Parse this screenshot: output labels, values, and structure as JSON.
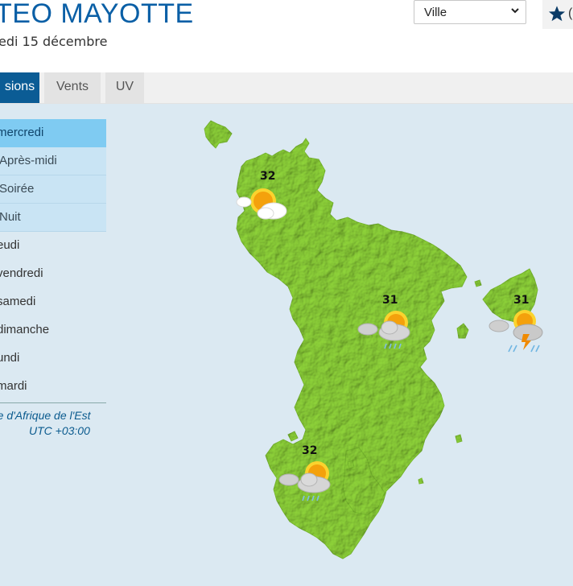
{
  "header": {
    "title": "TEO MAYOTTE",
    "date": "edi 15 décembre",
    "location_select": {
      "value": "Ville"
    },
    "favorite_label": "("
  },
  "tabs": [
    {
      "label": "sions",
      "active": true
    },
    {
      "label": "Vents",
      "active": false
    },
    {
      "label": "UV",
      "active": false
    }
  ],
  "sidebar": {
    "days": [
      {
        "label": "mercredi",
        "state": "active"
      },
      {
        "label": "Après-midi",
        "state": "sub"
      },
      {
        "label": "Soirée",
        "state": "sub"
      },
      {
        "label": "Nuit",
        "state": "sub"
      },
      {
        "label": "eudi",
        "state": "normal"
      },
      {
        "label": "vendredi",
        "state": "normal"
      },
      {
        "label": "samedi",
        "state": "normal"
      },
      {
        "label": "dimanche",
        "state": "normal"
      },
      {
        "label": "undi",
        "state": "normal"
      },
      {
        "label": "mardi",
        "state": "normal"
      }
    ],
    "timezone_line1": "re d'Afrique de l'Est",
    "timezone_line2": "UTC +03:00"
  },
  "map": {
    "land_color": "#8fd43a",
    "sea_color": "#dbe9f2",
    "forecasts": [
      {
        "temp": "32",
        "icon": "sun-cloud-icon"
      },
      {
        "temp": "31",
        "icon": "sun-cloud-rain-icon"
      },
      {
        "temp": "31",
        "icon": "storm-rain-icon"
      },
      {
        "temp": "32",
        "icon": "sun-cloud-rain-icon"
      }
    ]
  }
}
